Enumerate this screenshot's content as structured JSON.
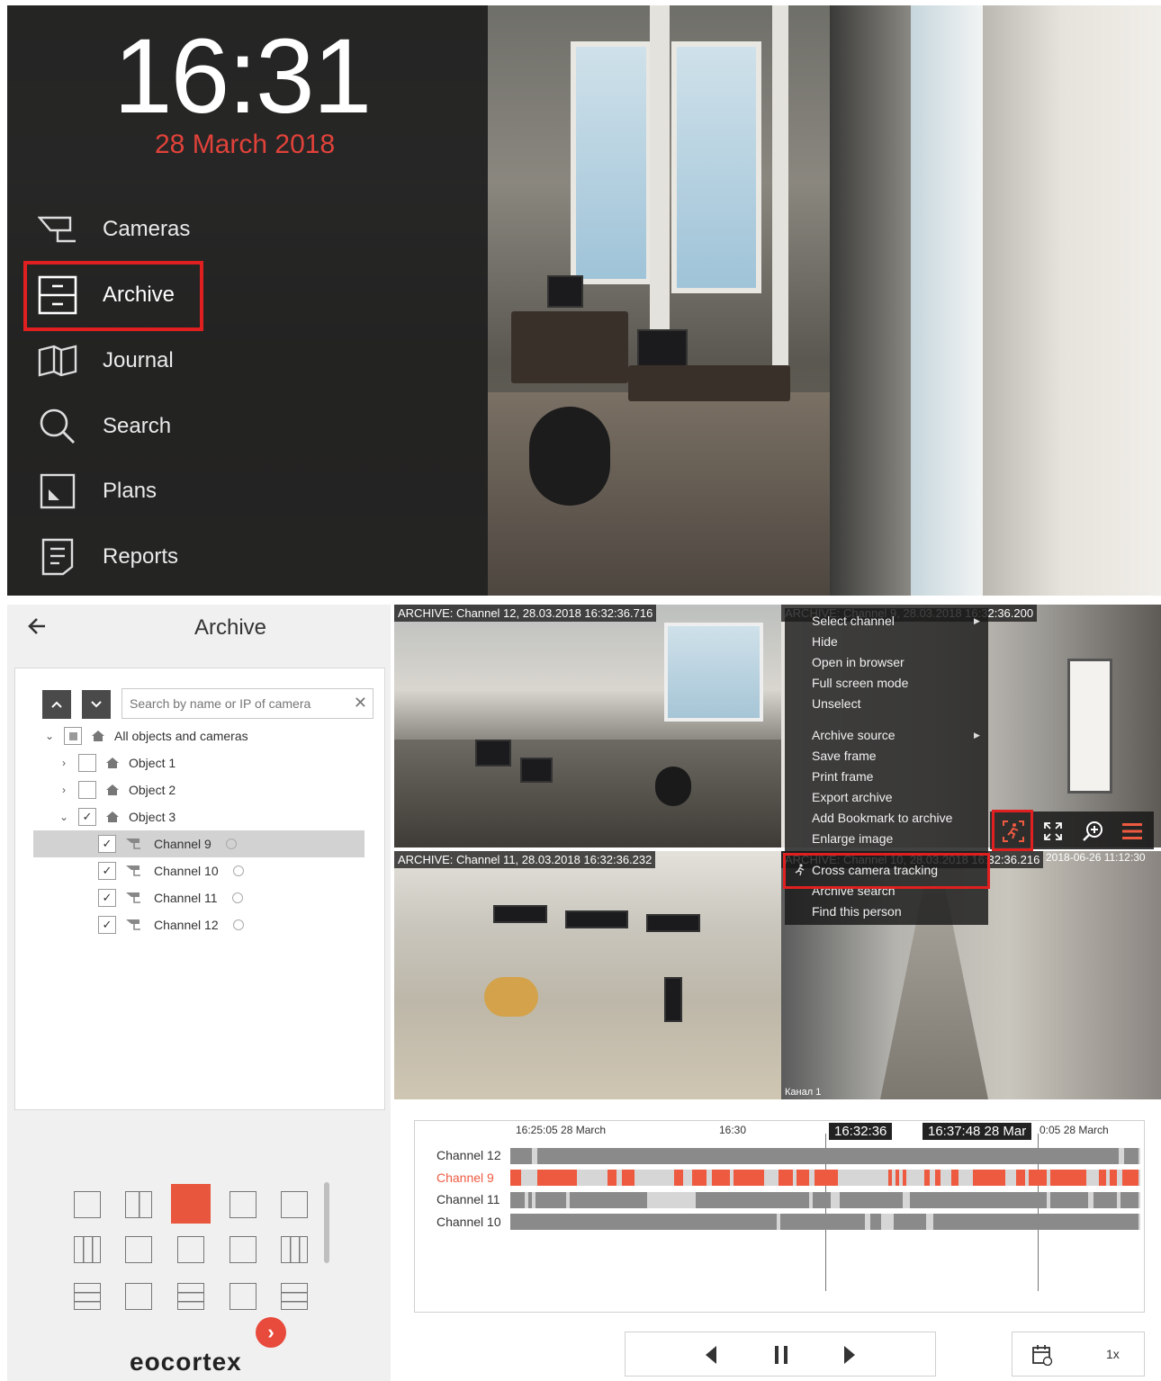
{
  "home": {
    "time": "16:31",
    "date": "28 March 2018",
    "menu": [
      {
        "label": "Cameras",
        "icon": "camera-icon"
      },
      {
        "label": "Archive",
        "icon": "archive-icon"
      },
      {
        "label": "Journal",
        "icon": "journal-icon"
      },
      {
        "label": "Search",
        "icon": "search-icon"
      },
      {
        "label": "Plans",
        "icon": "plans-icon"
      },
      {
        "label": "Reports",
        "icon": "reports-icon"
      }
    ],
    "highlighted": "Archive"
  },
  "archive": {
    "title": "Archive",
    "search_placeholder": "Search by name or IP of camera",
    "tree": {
      "root": "All objects and cameras",
      "objects": [
        "Object 1",
        "Object 2",
        "Object 3"
      ],
      "channels": [
        "Channel 9",
        "Channel 10",
        "Channel 11",
        "Channel 12"
      ],
      "selected_channel": "Channel 9"
    },
    "logo": "eocortex"
  },
  "tiles": [
    {
      "label": "ARCHIVE: Channel 12, 28.03.2018 16:32:36.716"
    },
    {
      "label": "ARCHIVE: Channel 9, 28.03.2018 16:32:36.200"
    },
    {
      "label": "ARCHIVE: Channel 11, 28.03.2018 16:32:36.232"
    },
    {
      "label": "ARCHIVE: Channel 10, 28.03.2018 16:32:36.216"
    }
  ],
  "tile_overlays": {
    "corridor_stamp": "2018-06-26 11:12:30",
    "corridor_caption": "Канал 1"
  },
  "context_menu": {
    "items": [
      "Select channel",
      "Hide",
      "Open in browser",
      "Full screen mode",
      "Unselect",
      "Archive source",
      "Save frame",
      "Print frame",
      "Export archive",
      "Add Bookmark to archive",
      "Enlarge image",
      "Cross camera tracking",
      "Archive search",
      "Find this person"
    ],
    "highlighted": "Cross camera tracking"
  },
  "timeline": {
    "ticks": [
      "16:25:05 28 March",
      "16:30",
      "0:05 28 March"
    ],
    "cursor_time": "16:32:36",
    "range_end": "16:37:48 28 Mar",
    "rows": [
      {
        "label": "Channel 12",
        "color": "#333333"
      },
      {
        "label": "Channel 9",
        "color": "#ee5a40"
      },
      {
        "label": "Channel 11",
        "color": "#333333"
      },
      {
        "label": "Channel 10",
        "color": "#333333"
      }
    ]
  },
  "playback": {
    "speed": "1x"
  },
  "colors": {
    "accent": "#e84a3c",
    "highlight_frame": "#e02020",
    "dark_panel": "#1e1e1e"
  }
}
